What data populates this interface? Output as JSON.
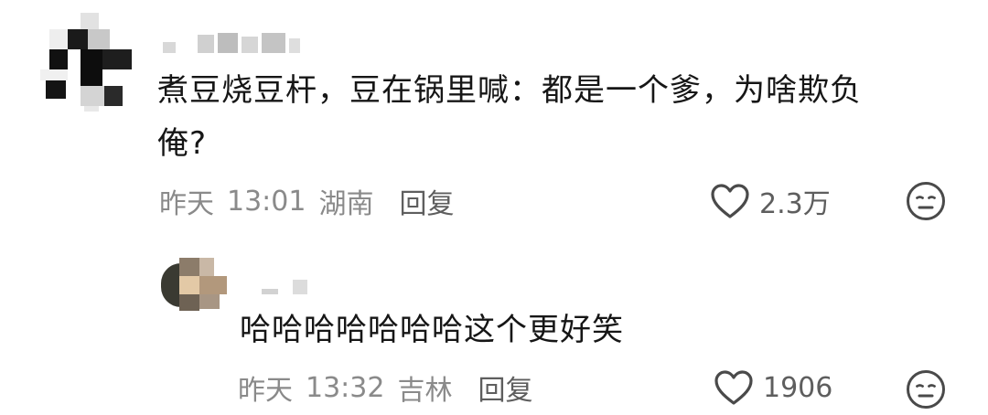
{
  "comments": [
    {
      "text": "煮豆烧豆杆，豆在锅里喊：都是一个爹，为啥欺负俺?",
      "line1": "煮豆烧豆杆，豆在锅里喊：都是一个爹，为啥欺负",
      "line2": "俺?",
      "date": "昨天",
      "time": "13:01",
      "region": "湖南",
      "reply_label": "回复",
      "likes": "2.3万",
      "reaction_icon": "neutral-face-icon",
      "like_icon": "heart-outline-icon"
    },
    {
      "text": "哈哈哈哈哈哈哈这个更好笑",
      "date": "昨天",
      "time": "13:32",
      "region": "吉林",
      "reply_label": "回复",
      "likes": "1906",
      "reaction_icon": "neutral-face-icon",
      "like_icon": "heart-outline-icon"
    }
  ],
  "colors": {
    "text": "#161616",
    "meta": "#8a8a8a",
    "action": "#5e5e5e"
  }
}
